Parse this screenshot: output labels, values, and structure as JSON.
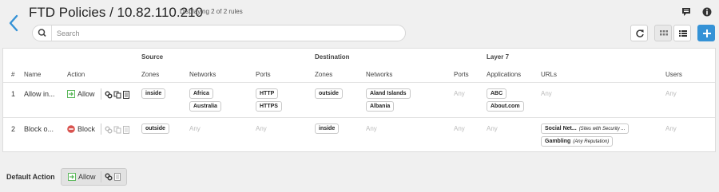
{
  "header": {
    "title": "FTD Policies / 10.82.110.210",
    "subtitle": "Displaying 2 of 2 rules",
    "icons": [
      "chevron-left-icon",
      "chat-icon",
      "info-icon"
    ]
  },
  "search": {
    "placeholder": "Search"
  },
  "toolbar": {
    "icons": [
      "refresh-icon",
      "grid-view-icon",
      "list-view-icon",
      "plus-icon"
    ]
  },
  "table": {
    "groups": {
      "source": "Source",
      "destination": "Destination",
      "layer7": "Layer 7"
    },
    "columns": [
      "#",
      "Name",
      "Action",
      "Zones",
      "Networks",
      "Ports",
      "Zones",
      "Networks",
      "Ports",
      "Applications",
      "URLs",
      "Users"
    ],
    "any_text": "Any",
    "rows": [
      {
        "num": "1",
        "name": "Allow in...",
        "action": "Allow",
        "action_icon": "allow-icon",
        "source_zones": [
          "inside"
        ],
        "source_networks": [
          "Africa",
          "Australia"
        ],
        "source_ports": [
          "HTTP",
          "HTTPS"
        ],
        "dest_zones": [
          "outside"
        ],
        "dest_networks": [
          "Aland Islands",
          "Albania"
        ],
        "dest_ports": [],
        "applications": [
          "ABC",
          "About.com"
        ],
        "urls": [],
        "users": []
      },
      {
        "num": "2",
        "name": "Block o...",
        "action": "Block",
        "action_icon": "block-icon",
        "source_zones": [
          "outside"
        ],
        "source_networks": [],
        "source_ports": [],
        "dest_zones": [
          "inside"
        ],
        "dest_networks": [],
        "dest_ports": [],
        "applications": [],
        "urls": [
          {
            "name": "Social Net...",
            "qualifier": "(Sites with Security ..."
          },
          {
            "name": "Gambling",
            "qualifier": "(Any Reputation)"
          }
        ],
        "users": []
      }
    ]
  },
  "default_action": {
    "label": "Default Action",
    "value": "Allow"
  },
  "colors": {
    "accent": "#3592d6",
    "allow": "#5cb85c",
    "block": "#d9534f"
  }
}
